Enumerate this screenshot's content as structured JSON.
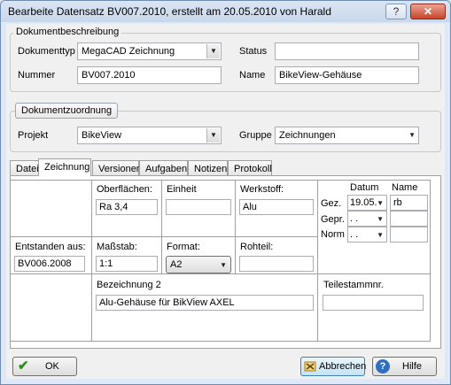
{
  "window": {
    "title": "Bearbeite Datensatz BV007.2010, erstellt am 20.05.2010 von Harald"
  },
  "titlebar_buttons": {
    "help": "?",
    "close": "✕"
  },
  "dokumentbeschreibung": {
    "legend": "Dokumentbeschreibung",
    "dokumenttyp_label": "Dokumenttyp",
    "dokumenttyp_value": "MegaCAD Zeichnung",
    "status_label": "Status",
    "status_value": "",
    "nummer_label": "Nummer",
    "nummer_value": "BV007.2010",
    "name_label": "Name",
    "name_value": "BikeView-Gehäuse"
  },
  "dokumentzuordnung": {
    "legend": "Dokumentzuordnung",
    "projekt_label": "Projekt",
    "projekt_value": "BikeView",
    "gruppe_label": "Gruppe",
    "gruppe_value": "Zeichnungen"
  },
  "tabs": [
    {
      "label": "Datei"
    },
    {
      "label": "Zeichnung"
    },
    {
      "label": "Versionen"
    },
    {
      "label": "Aufgaben"
    },
    {
      "label": "Notizen"
    },
    {
      "label": "Protokoll"
    }
  ],
  "active_tab": "Zeichnung",
  "zeichnung": {
    "oberflaechen_label": "Oberflächen:",
    "oberflaechen_value": "Ra 3,4",
    "einheit_label": "Einheit",
    "einheit_value": "",
    "werkstoff_label": "Werkstoff:",
    "werkstoff_value": "Alu",
    "datum_header": "Datum",
    "name_header": "Name",
    "gez_label": "Gez.",
    "gez_datum": "19.05.",
    "gez_name": "rb",
    "gepr_label": "Gepr.",
    "gepr_datum": ". .",
    "gepr_name": "",
    "norm_label": "Norm",
    "norm_datum": ". .",
    "norm_name": "",
    "entstanden_label": "Entstanden aus:",
    "entstanden_value": "BV006.2008",
    "massstab_label": "Maßstab:",
    "massstab_value": "1:1",
    "format_label": "Format:",
    "format_value": "A2",
    "rohteil_label": "Rohteil:",
    "rohteil_value": "",
    "bezeichnung_label": "Bezeichnung 2",
    "bezeichnung_value": "Alu-Gehäuse für BikView AXEL",
    "teilestamm_label": "Teilestammnr.",
    "teilestamm_value": ""
  },
  "buttons": {
    "ok": "OK",
    "abbrechen": "Abbrechen",
    "hilfe": "Hilfe"
  },
  "colors": {
    "ok_check": "#2e8b1e",
    "help_icon": "#2f6fc0",
    "cancel_icon": "#d8a030"
  }
}
